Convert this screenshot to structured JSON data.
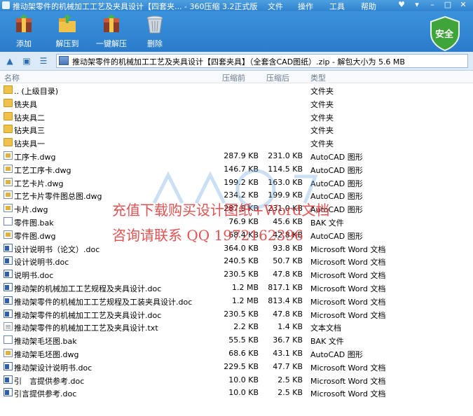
{
  "window": {
    "title": "推动架零件的机械加工工艺及夹具设计【四套夹... - 360压缩 3.2正式版",
    "menus": [
      "文件",
      "操作",
      "工具",
      "帮助"
    ]
  },
  "toolbar": {
    "buttons": [
      {
        "label": "添加",
        "icon": "add-archive-icon"
      },
      {
        "label": "解压到",
        "icon": "extract-to-icon"
      },
      {
        "label": "一键解压",
        "icon": "one-click-extract-icon"
      },
      {
        "label": "删除",
        "icon": "trash-icon"
      }
    ],
    "security_label": "安全"
  },
  "address": {
    "path": "推动架零件的机械加工工艺及夹具设计【四套夹具】（全套含CAD图纸）.zip - 解包大小为 5.6 MB"
  },
  "columns": {
    "name": "名称",
    "packed": "压缩前",
    "unpacked": "压缩后",
    "type": "类型"
  },
  "files": [
    {
      "icon": "up",
      "name": ".. (上级目录)",
      "packed": "",
      "unpacked": "",
      "type": "文件夹"
    },
    {
      "icon": "folder",
      "name": "铣夹具",
      "packed": "",
      "unpacked": "",
      "type": "文件夹"
    },
    {
      "icon": "folder",
      "name": "钻夹具二",
      "packed": "",
      "unpacked": "",
      "type": "文件夹"
    },
    {
      "icon": "folder",
      "name": "钻夹具三",
      "packed": "",
      "unpacked": "",
      "type": "文件夹"
    },
    {
      "icon": "folder",
      "name": "钻夹具一",
      "packed": "",
      "unpacked": "",
      "type": "文件夹"
    },
    {
      "icon": "dwg",
      "name": "工序卡.dwg",
      "packed": "287.9 KB",
      "unpacked": "231.0 KB",
      "type": "AutoCAD 图形"
    },
    {
      "icon": "dwg",
      "name": "工艺工序卡.dwg",
      "packed": "146.7 KB",
      "unpacked": "114.5 KB",
      "type": "AutoCAD 图形"
    },
    {
      "icon": "dwg",
      "name": "工艺卡片.dwg",
      "packed": "199.2 KB",
      "unpacked": "163.0 KB",
      "type": "AutoCAD 图形"
    },
    {
      "icon": "dwg",
      "name": "工艺卡片零件图总图.dwg",
      "packed": "234.2 KB",
      "unpacked": "199.9 KB",
      "type": "AutoCAD 图形"
    },
    {
      "icon": "dwg",
      "name": "卡片.dwg",
      "packed": "287.9 KB",
      "unpacked": "231.0 KB",
      "type": "AutoCAD 图形"
    },
    {
      "icon": "bak",
      "name": "零件图.bak",
      "packed": "76.9 KB",
      "unpacked": "45.6 KB",
      "type": "BAK 文件"
    },
    {
      "icon": "dwg",
      "name": "零件图.dwg",
      "packed": "68.4 KB",
      "unpacked": "42.8 KB",
      "type": "AutoCAD 图形"
    },
    {
      "icon": "doc",
      "name": "设计说明书（论文）.doc",
      "packed": "364.0 KB",
      "unpacked": "93.8 KB",
      "type": "Microsoft Word 文档"
    },
    {
      "icon": "doc",
      "name": "设计说明书.doc",
      "packed": "240.5 KB",
      "unpacked": "50.7 KB",
      "type": "Microsoft Word 文档"
    },
    {
      "icon": "doc",
      "name": "说明书.doc",
      "packed": "230.5 KB",
      "unpacked": "47.8 KB",
      "type": "Microsoft Word 文档"
    },
    {
      "icon": "doc",
      "name": "推动架的机械加工工艺规程及夹具设计.doc",
      "packed": "1.2 MB",
      "unpacked": "817.1 KB",
      "type": "Microsoft Word 文档"
    },
    {
      "icon": "doc",
      "name": "推动架零件的机械加工工艺规程及工装夹具设计.doc",
      "packed": "1.2 MB",
      "unpacked": "813.4 KB",
      "type": "Microsoft Word 文档"
    },
    {
      "icon": "doc",
      "name": "推动架零件的机械加工工艺及夹具设计.doc",
      "packed": "230.5 KB",
      "unpacked": "47.8 KB",
      "type": "Microsoft Word 文档"
    },
    {
      "icon": "txt",
      "name": "推动架零件的机械加工工艺及夹具设计.txt",
      "packed": "2.2 KB",
      "unpacked": "1.4 KB",
      "type": "文本文档"
    },
    {
      "icon": "bak",
      "name": "推动架毛坯图.bak",
      "packed": "55.5 KB",
      "unpacked": "36.7 KB",
      "type": "BAK 文件"
    },
    {
      "icon": "dwg",
      "name": "推动架毛坯图.dwg",
      "packed": "68.6 KB",
      "unpacked": "43.1 KB",
      "type": "AutoCAD 图形"
    },
    {
      "icon": "doc",
      "name": "推动架设计说明书.doc",
      "packed": "229.5 KB",
      "unpacked": "47.7 KB",
      "type": "Microsoft Word 文档"
    },
    {
      "icon": "doc",
      "name": "引　言提供参考.doc",
      "packed": "10.0 KB",
      "unpacked": "2.5 KB",
      "type": "Microsoft Word 文档"
    },
    {
      "icon": "doc",
      "name": "引言提供参考.doc",
      "packed": "10.0 KB",
      "unpacked": "2.5 KB",
      "type": "Microsoft Word 文档"
    }
  ],
  "watermark": {
    "line1": "充值下载购买设计图纸+Word文档",
    "line2": "咨询请联系  QQ 1972162396"
  }
}
